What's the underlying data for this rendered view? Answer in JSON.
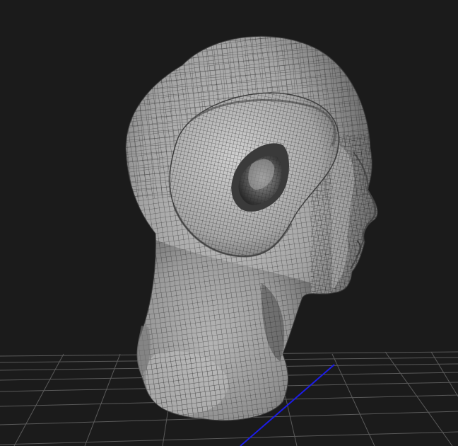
{
  "viewport": {
    "background_color": "#1b1b1b",
    "grid_color": "#5a5a5a",
    "axis_color": "#1a1ae6",
    "mesh_fill_light": "#b9b9b9",
    "mesh_fill_dark": "#5e5e5e",
    "wire_color": "#262626",
    "grid_visible": true,
    "wireframe_visible": true,
    "model": "sculpted-alien-head-wireframe"
  }
}
